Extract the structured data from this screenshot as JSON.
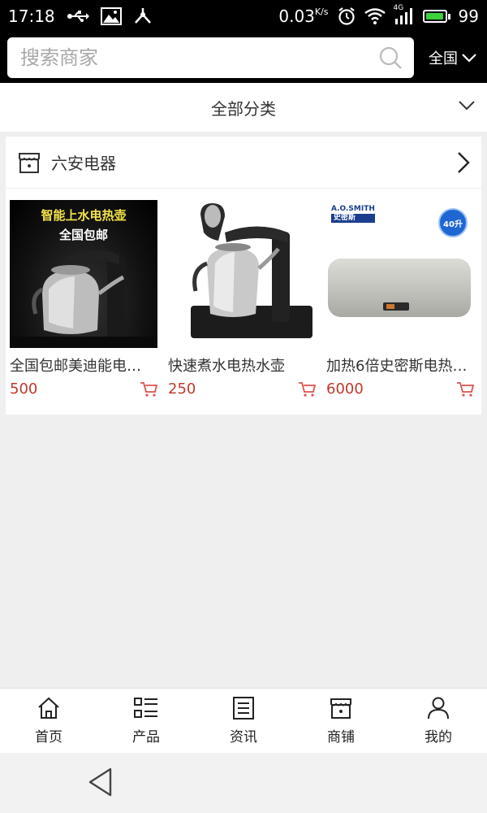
{
  "status_bar": {
    "time": "17:18",
    "speed": "0.03",
    "speed_unit": "K/s",
    "network": "4G",
    "battery": "99",
    "battery_fill": 0.99
  },
  "search": {
    "placeholder": "搜索商家"
  },
  "region": {
    "label": "全国"
  },
  "category": {
    "label": "全部分类"
  },
  "store": {
    "name": "六安电器",
    "products": [
      {
        "title": "全国包邮美迪能电…",
        "price": "500",
        "promo_line1": "智能上水电热壶",
        "promo_line2": "全国包邮"
      },
      {
        "title": "快速煮水电热水壶",
        "price": "250"
      },
      {
        "title": "加热6倍史密斯电热…",
        "price": "6000",
        "brand_en": "A.O.SMITH",
        "brand_cn": "史密斯",
        "badge": "40升"
      }
    ]
  },
  "bottom_nav": [
    {
      "label": "首页",
      "icon": "home-icon"
    },
    {
      "label": "产品",
      "icon": "list-icon"
    },
    {
      "label": "资讯",
      "icon": "news-icon"
    },
    {
      "label": "商铺",
      "icon": "store-icon"
    },
    {
      "label": "我的",
      "icon": "user-icon"
    }
  ],
  "colors": {
    "price": "#c0392b",
    "cart": "#d9534f",
    "header_bg": "#000000"
  }
}
